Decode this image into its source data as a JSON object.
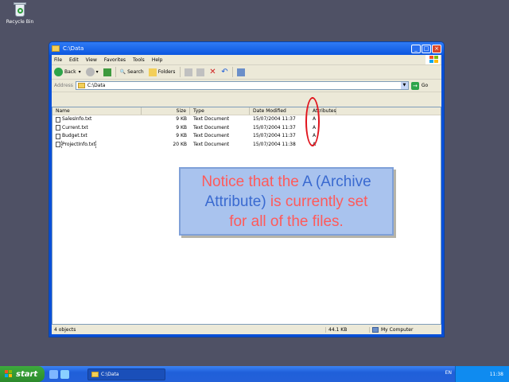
{
  "desktop": {
    "recycle_bin_label": "Recycle Bin"
  },
  "window": {
    "title": "C:\\Data",
    "menu": [
      "File",
      "Edit",
      "View",
      "Favorites",
      "Tools",
      "Help"
    ],
    "toolbar": {
      "back": "Back",
      "search": "Search",
      "folders": "Folders"
    },
    "address": {
      "label": "Address",
      "value": "C:\\Data",
      "go": "Go"
    },
    "columns": {
      "name": "Name",
      "size": "Size",
      "type": "Type",
      "date": "Date Modified",
      "attr": "Attributes"
    },
    "files": [
      {
        "name": "SalesInfo.txt",
        "size": "9 KB",
        "type": "Text Document",
        "date": "15/07/2004 11:37",
        "attr": "A"
      },
      {
        "name": "Current.txt",
        "size": "9 KB",
        "type": "Text Document",
        "date": "15/07/2004 11:37",
        "attr": "A"
      },
      {
        "name": "Budget.txt",
        "size": "9 KB",
        "type": "Text Document",
        "date": "15/07/2004 11:37",
        "attr": "A"
      },
      {
        "name": "ProjectInfo.txt",
        "size": "20 KB",
        "type": "Text Document",
        "date": "15/07/2004 11:38",
        "attr": "A"
      }
    ],
    "status": {
      "count": "4 objects",
      "size": "44.1 KB",
      "location": "My Computer"
    }
  },
  "callout": {
    "part1": "Notice that the ",
    "part2": "A (Archive",
    "part3": "Attribute)",
    "part4": " is currently set",
    "line3": "for all of the files."
  },
  "taskbar": {
    "start": "start",
    "task": "C:\\Data",
    "lang": "EN",
    "clock": "11:38"
  },
  "colors": {
    "accent_red": "#e0131c",
    "callout_bg": "#a9c3ee"
  }
}
